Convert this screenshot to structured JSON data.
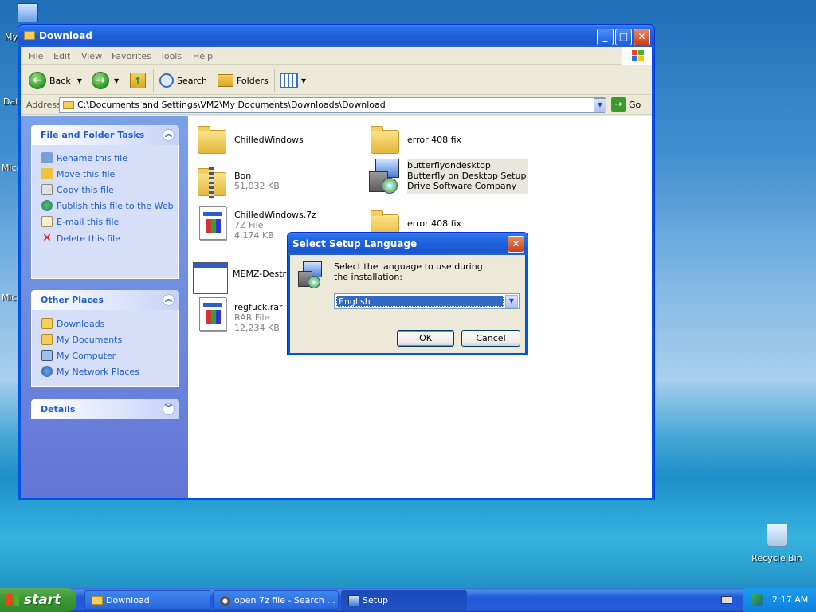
{
  "desktop": {
    "icons": [
      {
        "label": "My"
      },
      {
        "label": "Dat"
      },
      {
        "label": "Micr"
      },
      {
        "label": "Micr"
      }
    ],
    "recycle_bin": "Recycle Bin"
  },
  "window": {
    "title": "Download",
    "menu": [
      "File",
      "Edit",
      "View",
      "Favorites",
      "Tools",
      "Help"
    ],
    "toolbar": {
      "back": "Back",
      "search": "Search",
      "folders": "Folders"
    },
    "address": {
      "label": "Address",
      "value": "C:\\Documents and Settings\\VM2\\My Documents\\Downloads\\Download",
      "go": "Go"
    },
    "tasks_panel": {
      "title": "File and Folder Tasks",
      "items": [
        "Rename this file",
        "Move this file",
        "Copy this file",
        "Publish this file to the Web",
        "E-mail this file",
        "Delete this file"
      ]
    },
    "places_panel": {
      "title": "Other Places",
      "items": [
        "Downloads",
        "My Documents",
        "My Computer",
        "My Network Places"
      ]
    },
    "details_panel": {
      "title": "Details"
    },
    "files": [
      {
        "name": "ChilledWindows",
        "type": "",
        "size": ""
      },
      {
        "name": "error 408 fix",
        "type": "",
        "size": ""
      },
      {
        "name": "Bon",
        "type": "",
        "size": "51,032 KB"
      },
      {
        "name": "butterflyondesktop",
        "type": "Butterfly on Desktop Setup",
        "size": "Drive Software Company"
      },
      {
        "name": "ChilledWindows.7z",
        "type": "7Z File",
        "size": "4,174 KB"
      },
      {
        "name": "error 408 fix",
        "type": "",
        "size": ""
      },
      {
        "name": "MEMZ-Destruc",
        "type": "",
        "size": ""
      },
      {
        "name": "regfuck.rar",
        "type": "RAR File",
        "size": "12,234 KB"
      }
    ]
  },
  "dialog": {
    "title": "Select Setup Language",
    "message": "Select the language to use during the installation:",
    "selected_language": "English",
    "ok": "OK",
    "cancel": "Cancel"
  },
  "taskbar": {
    "start": "start",
    "tasks": [
      {
        "label": "Download"
      },
      {
        "label": "open 7z file - Search ..."
      },
      {
        "label": "Setup"
      }
    ],
    "clock": "2:17 AM"
  },
  "colors": {
    "title_blue": "#0054e3",
    "link_blue": "#215dc6",
    "face": "#ece9d8",
    "start_green": "#3c9a34"
  }
}
